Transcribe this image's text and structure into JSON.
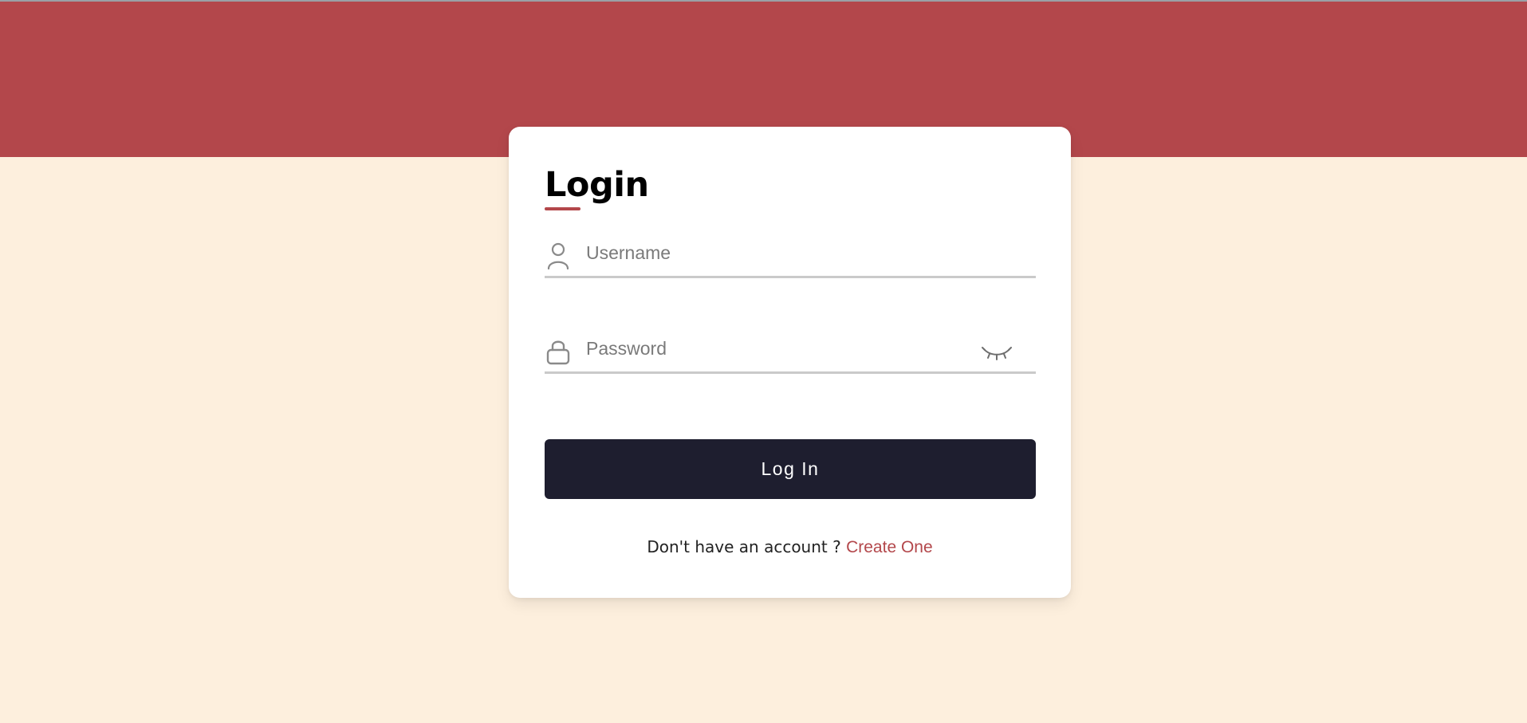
{
  "header": {
    "color": "#B3474B"
  },
  "page": {
    "background_color": "#FDEFDD"
  },
  "login_card": {
    "title": "Login",
    "username": {
      "placeholder": "Username",
      "value": "",
      "icon": "user-icon"
    },
    "password": {
      "placeholder": "Password",
      "value": "",
      "icon": "lock-icon",
      "toggle_icon": "eye-closed-icon"
    },
    "submit_label": "Log In",
    "signup_prompt": "Don't have an account ?",
    "signup_link": "Create One",
    "accent_color": "#B3474B",
    "button_color": "#1E1E2F"
  }
}
